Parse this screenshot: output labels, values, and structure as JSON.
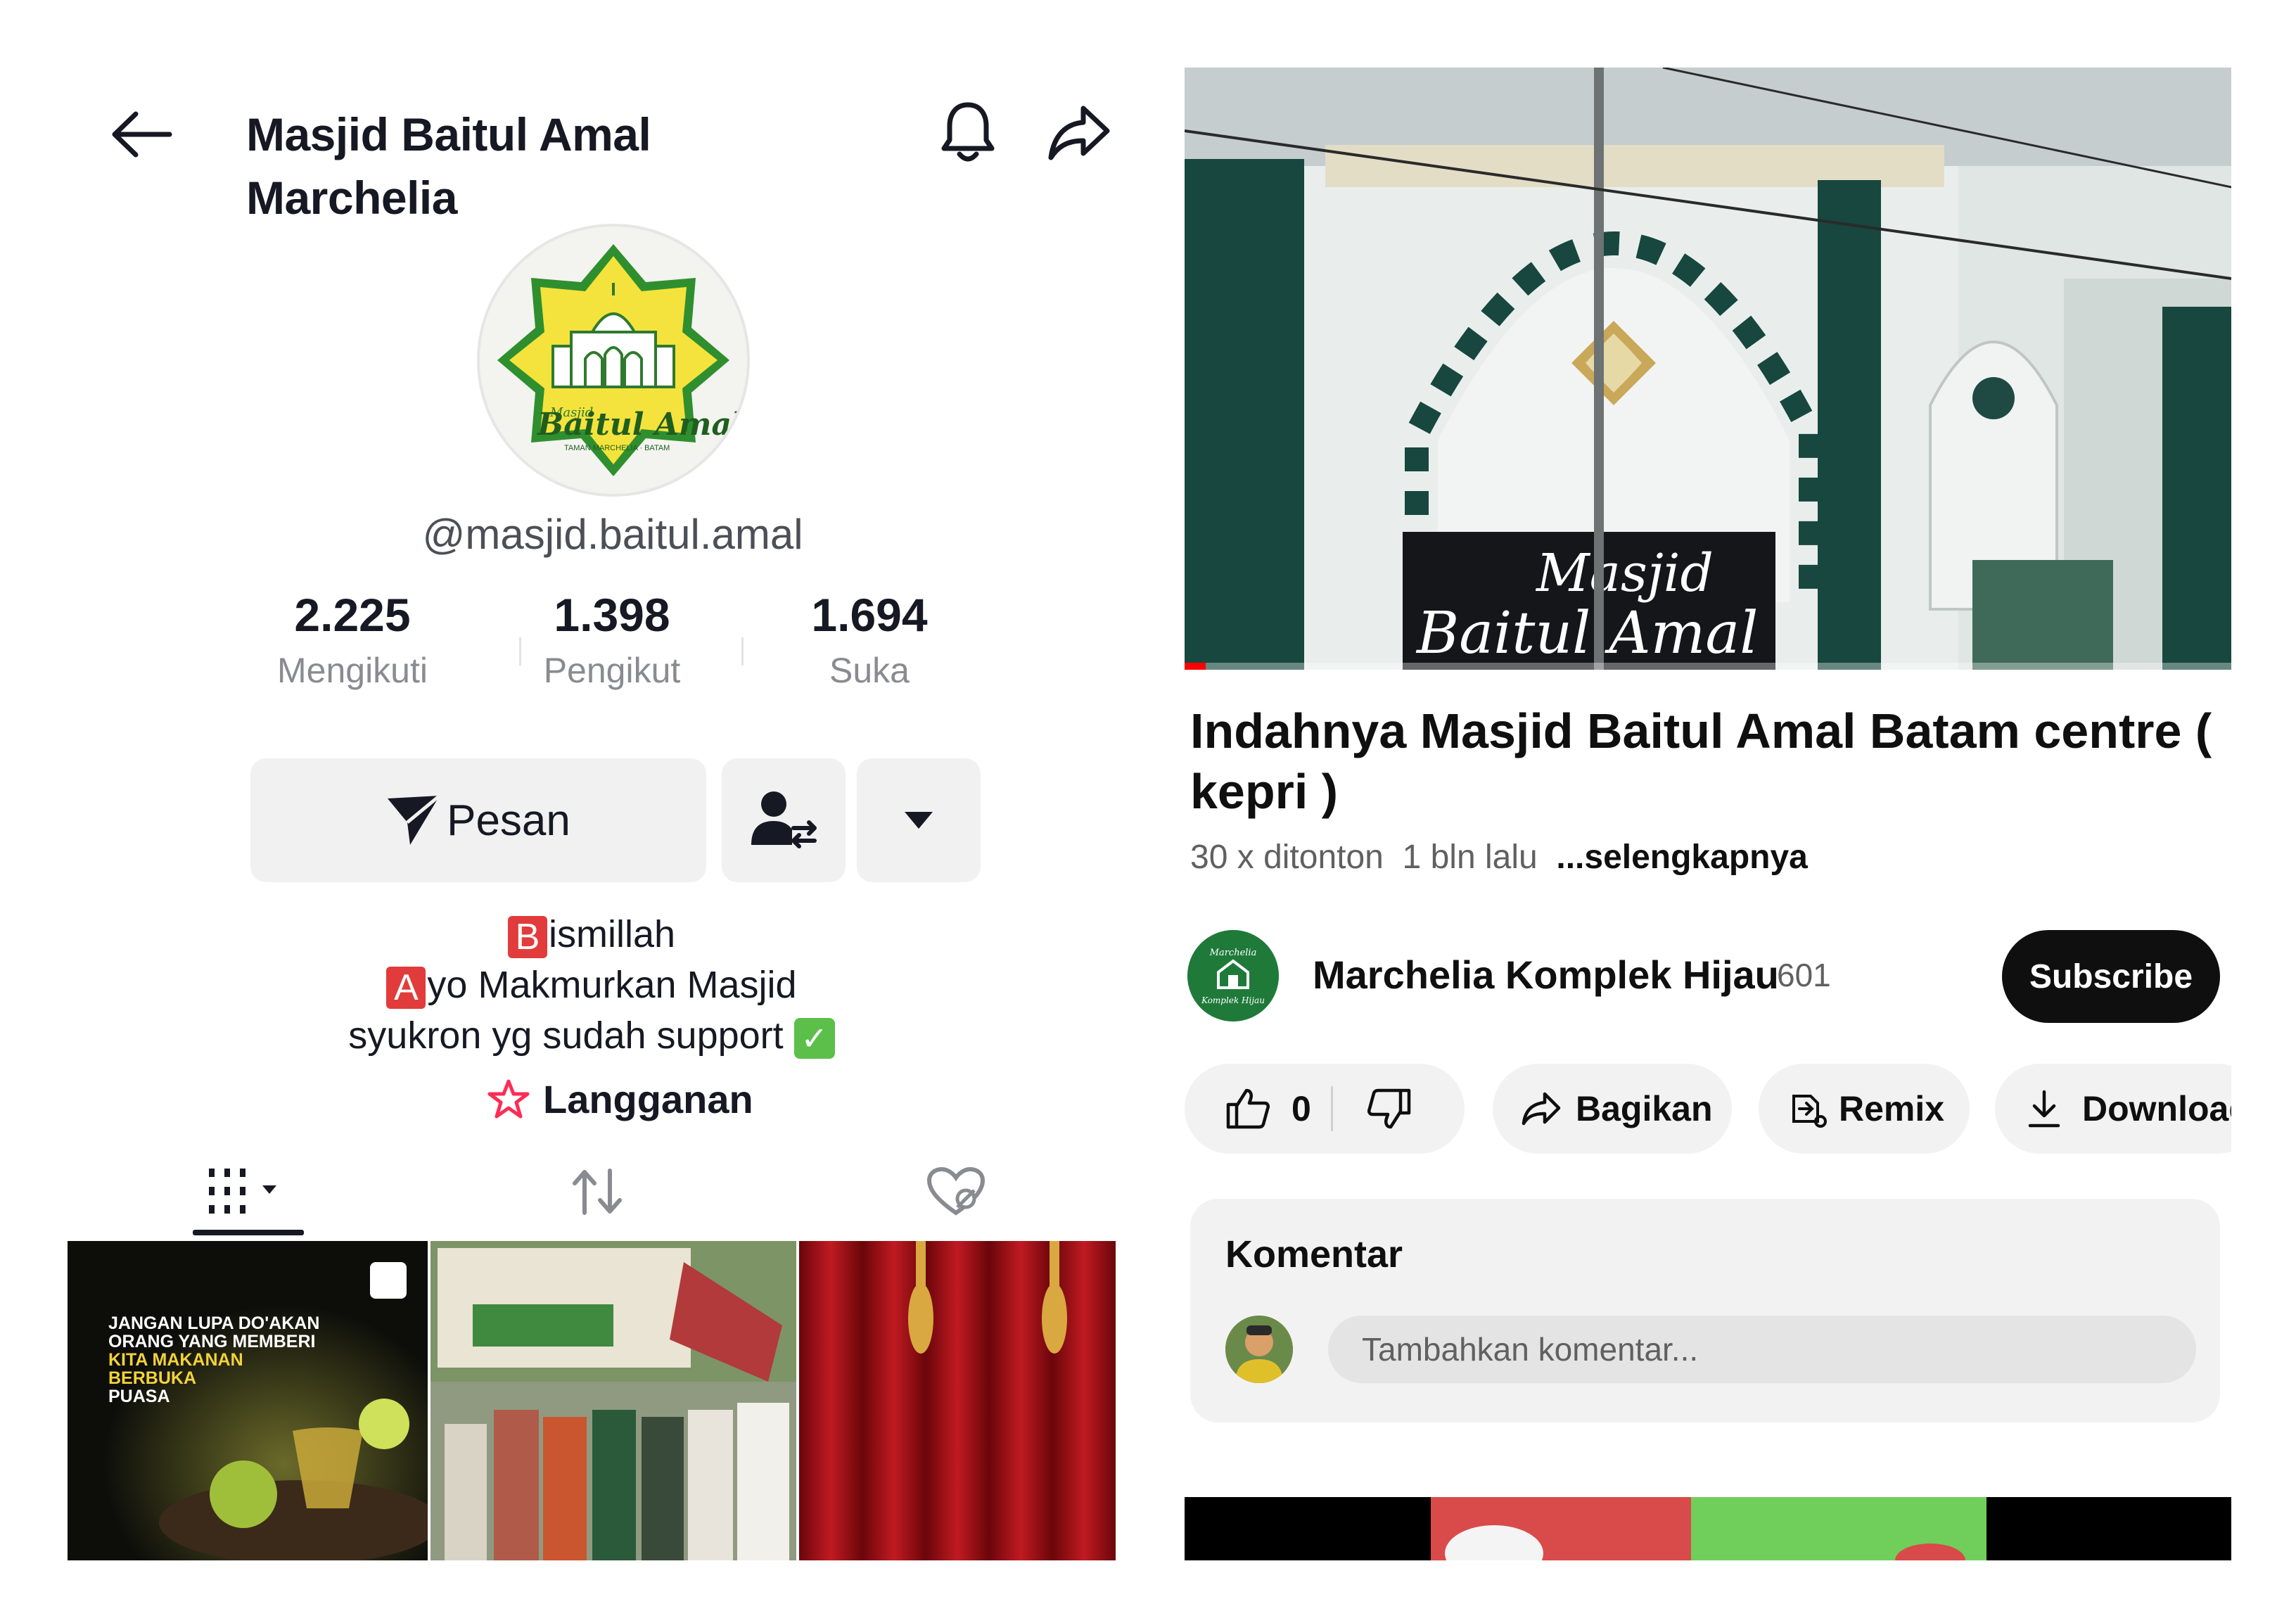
{
  "tiktok": {
    "header": {
      "title": "Masjid Baitul Amal Marchelia"
    },
    "logo": {
      "script_text": "Baitul Amal",
      "small_text": "Masjid",
      "sub_text": "TAMAN MARCHELIA · BATAM"
    },
    "username": "@masjid.baitul.amal",
    "stats": [
      {
        "value": "2.225",
        "label": "Mengikuti"
      },
      {
        "value": "1.398",
        "label": "Pengikut"
      },
      {
        "value": "1.694",
        "label": "Suka"
      }
    ],
    "actions": {
      "message_label": "Pesan"
    },
    "bio": {
      "line1_initial": "B",
      "line1_rest": "ismillah",
      "line2_initial": "A",
      "line2_rest": "yo Makmurkan Masjid",
      "line3": "syukron yg sudah support",
      "line3_emoji": "✓"
    },
    "subscription_label": "Langganan",
    "grid": {
      "post1_text": [
        "JANGAN LUPA DO'AKAN",
        "ORANG YANG MEMBERI",
        "KITA MAKANAN",
        "BERBUKA",
        "PUASA"
      ]
    },
    "colors": {
      "accent_red": "#e23b3b",
      "logo_yellow": "#f4e33c",
      "logo_green": "#2f8f2f"
    }
  },
  "youtube": {
    "video": {
      "sign_line1": "Masjid",
      "sign_line2": "Baitul Amal",
      "progress": 0.02
    },
    "title": "Indahnya Masjid Baitul Amal Batam centre ( kepri )",
    "meta": {
      "views": "30 x ditonton",
      "age": "1 bln lalu",
      "more": "...selengkapnya"
    },
    "channel": {
      "name": "Marchelia Komplek Hijau",
      "subscribers": "601",
      "avatar_text_top": "Marchelia",
      "avatar_text_bottom": "Komplek Hijau"
    },
    "subscribe_label": "Subscribe",
    "actions": {
      "likes": "0",
      "share": "Bagikan",
      "remix": "Remix",
      "download": "Download"
    },
    "comments": {
      "title": "Komentar",
      "placeholder": "Tambahkan komentar..."
    },
    "colors": {
      "subscribe_bg": "#0f0f0f",
      "progress_red": "#ff0000",
      "pill_bg": "#f2f2f2"
    }
  }
}
